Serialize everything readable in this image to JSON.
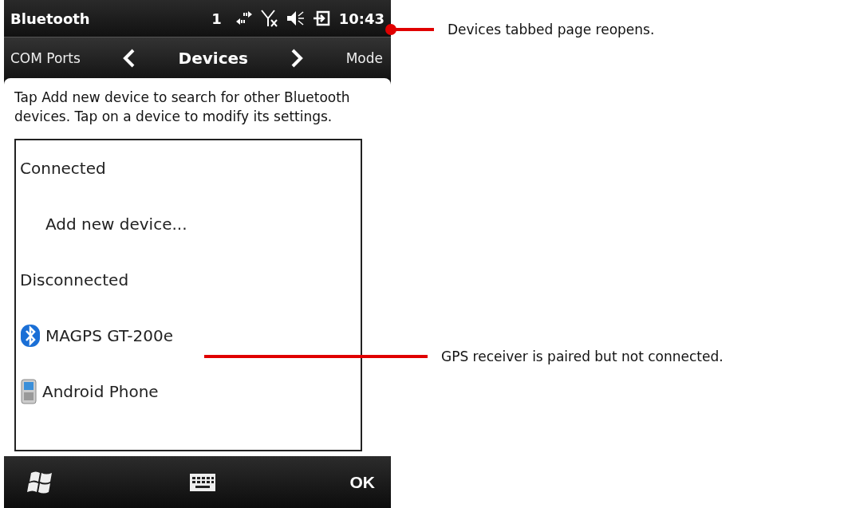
{
  "title_bar": {
    "title": "Bluetooth",
    "notification_count": "1",
    "time": "10:43"
  },
  "tabs": [
    {
      "label": "COM Ports",
      "selected": false
    },
    {
      "label": "Devices",
      "selected": true
    },
    {
      "label": "Mode",
      "selected": false
    }
  ],
  "description": "Tap Add new device to search for other Bluetooth devices. Tap on a device to modify its settings.",
  "device_list": [
    {
      "kind": "header",
      "label": "Connected"
    },
    {
      "kind": "action",
      "label": "Add new device..."
    },
    {
      "kind": "header",
      "label": "Disconnected"
    },
    {
      "kind": "bluetooth_device",
      "label": "MAGPS GT-200e"
    },
    {
      "kind": "phone_device",
      "label": "Android Phone"
    }
  ],
  "soft_keys": {
    "right": "OK"
  },
  "annotations": [
    {
      "text": "Devices tabbed page reopens."
    },
    {
      "text": "GPS receiver is paired but not connected."
    }
  ]
}
